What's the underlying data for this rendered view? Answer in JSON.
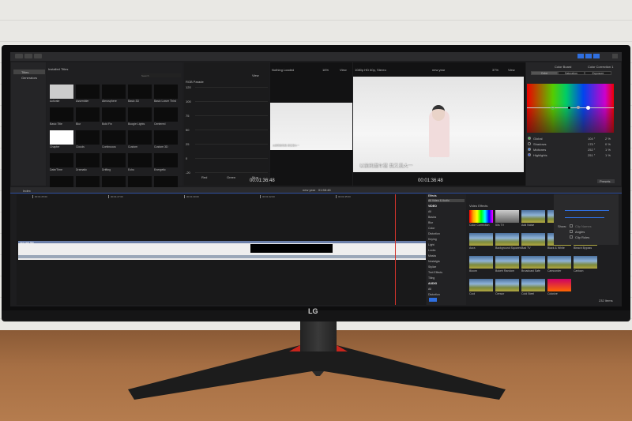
{
  "monitor": {
    "brand": "LG"
  },
  "toolbar": {
    "buttons": [
      "import",
      "keyword",
      "background-tasks"
    ]
  },
  "library": {
    "items": [
      {
        "label": "Titles",
        "selected": true
      },
      {
        "label": "Generators",
        "selected": false
      }
    ]
  },
  "browser": {
    "title": "Installed Titles",
    "search_placeholder": "Search",
    "titles": [
      "Activate",
      "Assembler",
      "Atmosphere",
      "Basic 3D",
      "Basic Lower Third",
      "Basic Title",
      "Blur",
      "Bold Fin",
      "Boogie Lights",
      "Centered",
      "Chapter",
      "Clouds",
      "Continuous",
      "Custom",
      "Custom 3D",
      "Date/Time",
      "Dramatic",
      "Drifting",
      "Echo",
      "Energetic",
      "",
      "",
      "",
      "",
      ""
    ]
  },
  "scope": {
    "title": "RGB Parade",
    "view": "View",
    "ticks": [
      "120",
      "100",
      "75",
      "50",
      "25",
      "0",
      "-20"
    ],
    "channels": [
      "Red",
      "Green",
      "Blue"
    ]
  },
  "event_viewer": {
    "status": "Nothing Loaded",
    "zoom": "16%",
    "view": "View",
    "timecode": "00:01:36:48",
    "subtitle": "以前的過年是 我又長大一"
  },
  "viewer": {
    "format": "1080p HD 60p, Stereo",
    "project": "new year",
    "zoom": "37%",
    "view": "View",
    "timecode": "00:01:36:48",
    "subtitle": "以前的過年是 我又長大一"
  },
  "inspector": {
    "title": "Color Board",
    "correction": "Color Correction 1",
    "tabs": [
      "Color",
      "Saturation",
      "Exposure"
    ],
    "active_tab": "Color",
    "rows": [
      {
        "label": "Global",
        "angle": "104 °",
        "pct": "2 %",
        "color": "#3fc24a"
      },
      {
        "label": "Shadows",
        "angle": "175 °",
        "pct": "0 %",
        "color": "#111111"
      },
      {
        "label": "Midtones",
        "angle": "252 °",
        "pct": "1 %",
        "color": "#2a7ee8"
      },
      {
        "label": "Highlights",
        "angle": "251 °",
        "pct": "1 %",
        "color": "#2a50e8"
      }
    ],
    "presets": "Presets"
  },
  "timeline": {
    "index": "Index",
    "project": "new year",
    "duration": "01:58:48",
    "ruler": [
      "00:01:25:00",
      "00:01:27:00",
      "00:01:30:00",
      "00:01:32:00",
      "00:01:35:00"
    ],
    "clip": "new year 60p"
  },
  "effects": {
    "header": "Effects",
    "categories": [
      "All Video & Audio",
      "VIDEO",
      "All",
      "Basics",
      "Blur",
      "Color",
      "Distortion",
      "Keying",
      "Light",
      "Looks",
      "Masks",
      "Nostalgia",
      "Stylize",
      "Text Effects",
      "Tiling",
      "AUDIO",
      "All",
      "Distortion"
    ],
    "selected": "All Video & Audio",
    "section": "Video Effects",
    "items": [
      "Color Correction",
      "50s TV",
      "Add Noise",
      "",
      "Artifacts",
      "Aura",
      "Background Squares",
      "Bad TV",
      "Black & White",
      "Bleach Bypass",
      "Bloom",
      "Bokeh Random",
      "Broadcast Safe",
      "Camcorder",
      "Cartoon",
      "Cool",
      "Censor",
      "Cold Steel",
      "Colorize"
    ],
    "count": "232 Items"
  },
  "clip_appearance": {
    "show_label": "Show:",
    "options": [
      {
        "label": "Clip Names",
        "checked": false,
        "disabled": true
      },
      {
        "label": "Angles",
        "checked": false
      },
      {
        "label": "Clip Roles",
        "checked": false
      }
    ]
  },
  "colors": {
    "accent": "#2f6fe0",
    "playhead": "#d0342c",
    "stand_accent": "#c8251c"
  }
}
